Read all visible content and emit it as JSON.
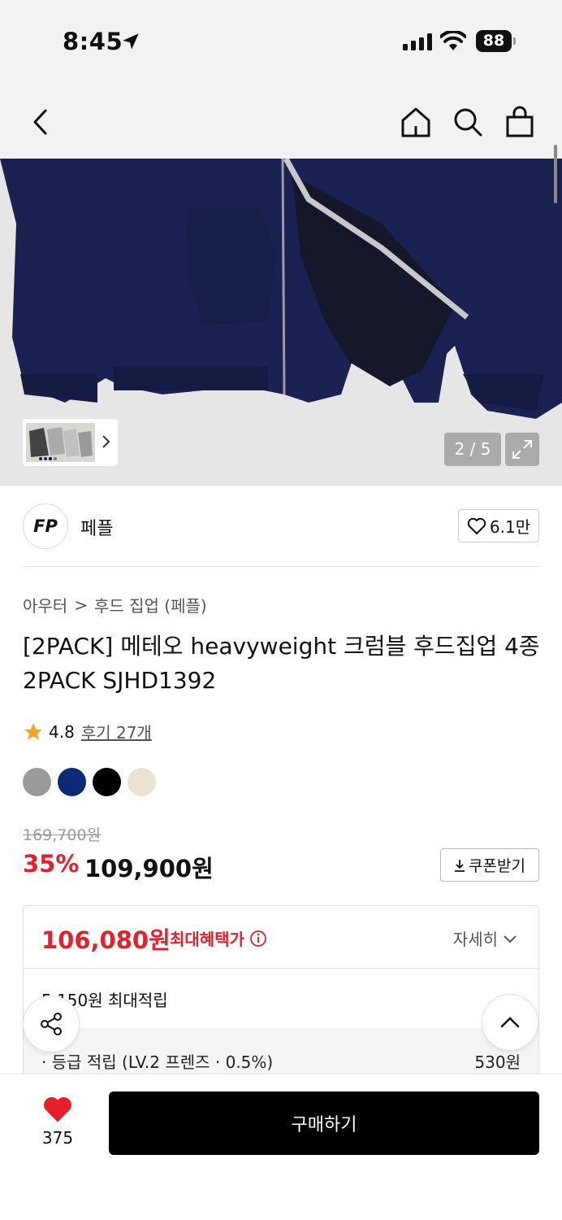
{
  "status_bar": {
    "time": "8:45",
    "battery": "88"
  },
  "nav": {
    "back": "chevron-left-icon",
    "home": "home-icon",
    "search": "search-icon",
    "bag": "shopping-bag-icon"
  },
  "gallery": {
    "counter": "2 / 5",
    "expand": "expand-icon"
  },
  "brand": {
    "logo_text": "FP",
    "name": "페플",
    "likes": "6.1만"
  },
  "breadcrumb": {
    "category": "아우터",
    "separator": ">",
    "subcategory": "후드 집업 (페플)"
  },
  "product": {
    "title": "[2PACK] 메테오 heavyweight 크럼블 후드집업 4종 2PACK SJHD1392",
    "rating": "4.8",
    "reviews": "후기 27개",
    "swatches": [
      "#9a9a9a",
      "#0d2a7a",
      "#000000",
      "#e8e3d3"
    ]
  },
  "price": {
    "original": "169,700원",
    "discount_rate": "35%",
    "sale": "109,900원",
    "coupon_button": "쿠폰받기"
  },
  "benefit": {
    "price": "106,080원",
    "label": "최대혜택가",
    "detail": "자세히",
    "max_points": "5,150원 최대적립",
    "grade_label": "· 등급 적립 (LV.2 프렌즈 · 0.5%)",
    "grade_value": "530원"
  },
  "bottom": {
    "wish_count": "375",
    "buy_label": "구매하기"
  },
  "colors": {
    "accent_red": "#e5202b",
    "heart_red": "#e5202b",
    "buy_black": "#000000"
  }
}
